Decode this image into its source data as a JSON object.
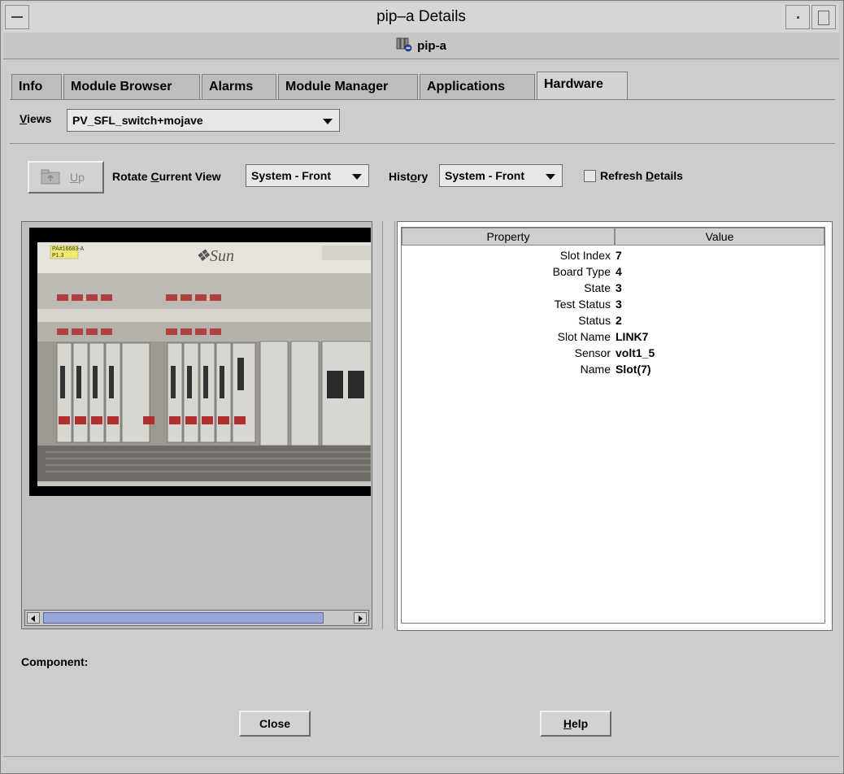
{
  "window": {
    "title": "pip–a Details",
    "host_label": "pip-a",
    "host_icon": "server-agent-icon"
  },
  "tabs": [
    {
      "label": "Info",
      "active": false
    },
    {
      "label": "Module Browser",
      "active": false
    },
    {
      "label": "Alarms",
      "active": false
    },
    {
      "label": "Module Manager",
      "active": false
    },
    {
      "label": "Applications",
      "active": false
    },
    {
      "label": "Hardware",
      "active": true
    }
  ],
  "views": {
    "label_prefix": "V",
    "label_rest": "iews",
    "selected": "PV_SFL_switch+mojave"
  },
  "toolbar": {
    "up_label_u": "U",
    "up_label_rest": "p",
    "rotate_prefix": "Rotate ",
    "rotate_u": "C",
    "rotate_rest": "urrent View",
    "rotate_selected": "System - Front",
    "history_prefix": "Hist",
    "history_u": "o",
    "history_rest": "ry",
    "history_selected": "System - Front",
    "refresh_prefix": "Refresh ",
    "refresh_u": "D",
    "refresh_rest": "etails",
    "refresh_checked": false
  },
  "hardware_image": {
    "badge_line1": "PA#16683-A",
    "badge_line2": "P1.3",
    "brand": "Sun"
  },
  "properties": {
    "headers": [
      "Property",
      "Value"
    ],
    "rows": [
      {
        "key": "Slot Index",
        "value": "7"
      },
      {
        "key": "Board Type",
        "value": "4"
      },
      {
        "key": "State",
        "value": "3"
      },
      {
        "key": "Test Status",
        "value": "3"
      },
      {
        "key": "Status",
        "value": "2"
      },
      {
        "key": "Slot Name",
        "value": "LINK7"
      },
      {
        "key": "Sensor",
        "value": "volt1_5"
      },
      {
        "key": "Name",
        "value": "Slot(7)"
      }
    ]
  },
  "component_label": "Component:",
  "buttons": {
    "close": "Close",
    "help_u": "H",
    "help_rest": "elp"
  }
}
